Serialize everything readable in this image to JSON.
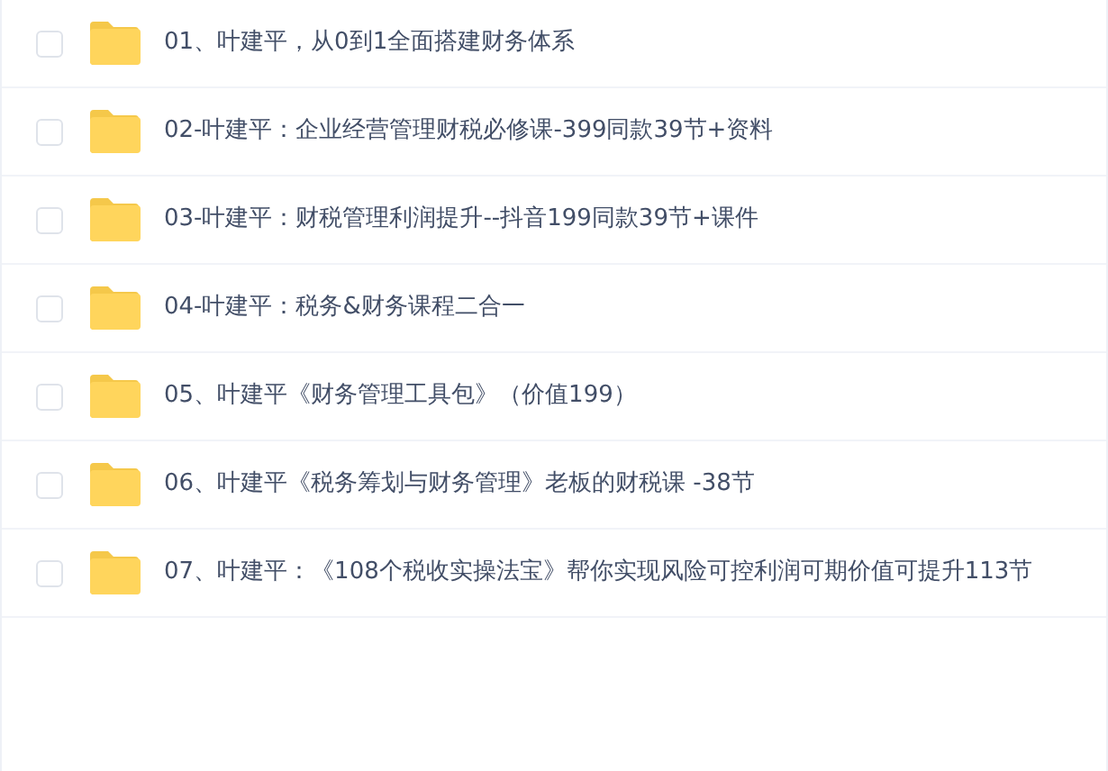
{
  "files": [
    {
      "name": "01、叶建平，从0到1全面搭建财务体系",
      "checked": false
    },
    {
      "name": "02-叶建平：企业经营管理财税必修课-399同款39节+资料",
      "checked": false
    },
    {
      "name": "03-叶建平：财税管理利润提升--抖音199同款39节+课件",
      "checked": false
    },
    {
      "name": "04-叶建平：税务&财务课程二合一",
      "checked": false
    },
    {
      "name": "05、叶建平《财务管理工具包》（价值199）",
      "checked": false
    },
    {
      "name": "06、叶建平《税务筹划与财务管理》老板的财税课 -38节",
      "checked": false
    },
    {
      "name": "07、叶建平：《108个税收实操法宝》帮你实现风险可控利润可期价值可提升113节",
      "checked": false
    }
  ]
}
